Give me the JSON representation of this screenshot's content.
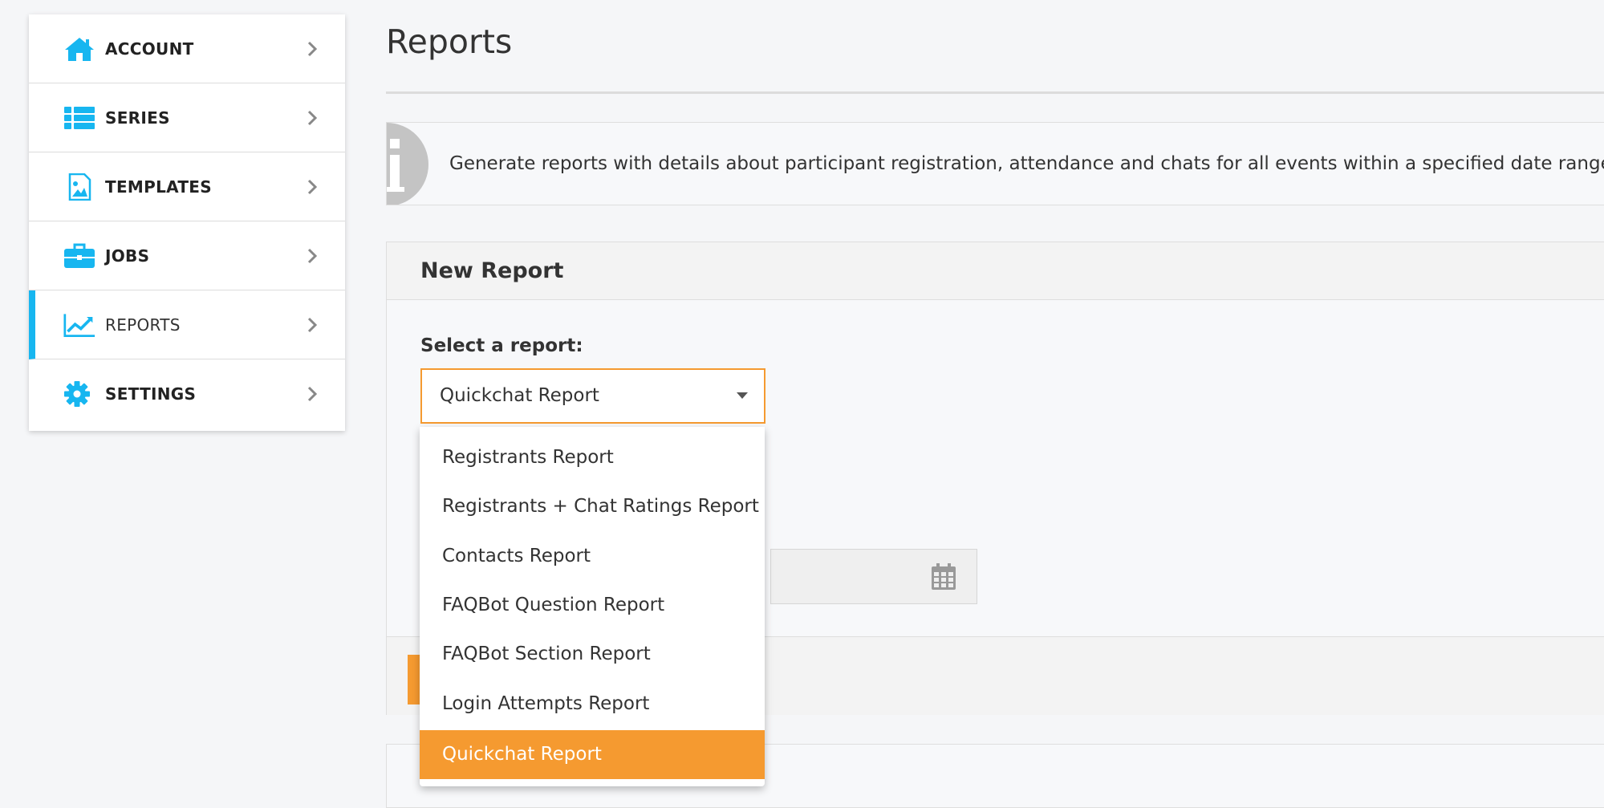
{
  "sidebar": {
    "items": [
      {
        "label": "ACCOUNT",
        "icon": "home-icon"
      },
      {
        "label": "SERIES",
        "icon": "list-icon"
      },
      {
        "label": "TEMPLATES",
        "icon": "image-file-icon"
      },
      {
        "label": "JOBS",
        "icon": "briefcase-icon"
      },
      {
        "label": "REPORTS",
        "icon": "line-chart-icon",
        "active": true
      },
      {
        "label": "SETTINGS",
        "icon": "gear-icon"
      }
    ],
    "accent_color": "#17b6f0"
  },
  "page": {
    "title": "Reports",
    "info_text": "Generate reports with details about participant registration, attendance and chats for all events within a specified date range."
  },
  "new_report": {
    "title": "New Report",
    "select_label": "Select a report:",
    "selected_value": "Quickchat Report",
    "options": [
      "Registrants Report",
      "Registrants + Chat Ratings Report",
      "Contacts Report",
      "FAQBot Question Report",
      "FAQBot Section Report",
      "Login Attempts Report",
      "Quickchat Report"
    ],
    "selected_index": 6,
    "accent_color": "#f59a30"
  }
}
